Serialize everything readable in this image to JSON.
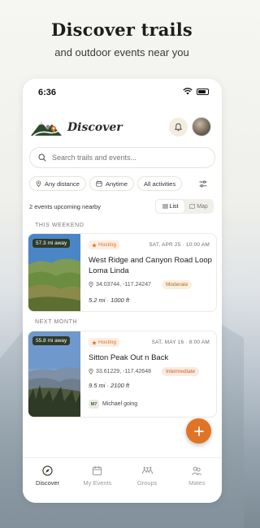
{
  "hero": {
    "title": "Discover trails",
    "subtitle": "and outdoor events near you"
  },
  "status_bar": {
    "time": "6:36"
  },
  "header": {
    "title": "Discover"
  },
  "search": {
    "placeholder": "Search trails and events..."
  },
  "filters": [
    {
      "label": "Any distance",
      "icon": "pin-icon"
    },
    {
      "label": "Anytime",
      "icon": "calendar-icon"
    },
    {
      "label": "All activities",
      "icon": ""
    }
  ],
  "summary": {
    "count_text": "2 events upcoming nearby"
  },
  "view_toggle": {
    "list": "List",
    "map": "Map",
    "selected": "List"
  },
  "sections": [
    {
      "label": "THIS WEEKEND",
      "event": {
        "distance": "57.3 mi away",
        "badge": "Hosting",
        "date": "SAT, APR 25 · 10:00 AM",
        "title": "West Ridge and Canyon Road Loop Loma Linda",
        "coords": "34.03744, -117.24247",
        "difficulty": "Moderate",
        "stats": "5.2 mi · 1000 ft"
      }
    },
    {
      "label": "NEXT MONTH",
      "event": {
        "distance": "55.8 mi away",
        "badge": "Hosting",
        "date": "SAT, MAY 16 · 8:00 AM",
        "title": "Sitton Peak Out n Back",
        "coords": "33.61229, -117.42648",
        "difficulty": "Intermediate",
        "stats": "9.5 mi · 2100 ft",
        "attendee_initials": "M7",
        "attendee_text": "Michael going"
      }
    }
  ],
  "tabbar": [
    {
      "label": "Discover",
      "icon": "compass-icon",
      "active": true
    },
    {
      "label": "My Events",
      "icon": "calendar-icon",
      "active": false
    },
    {
      "label": "Groups",
      "icon": "group-icon",
      "active": false
    },
    {
      "label": "Mates",
      "icon": "mates-icon",
      "active": false
    }
  ],
  "colors": {
    "accent": "#e07425",
    "brand_green": "#2d4a2e",
    "badge_bg": "#fdeee3"
  }
}
